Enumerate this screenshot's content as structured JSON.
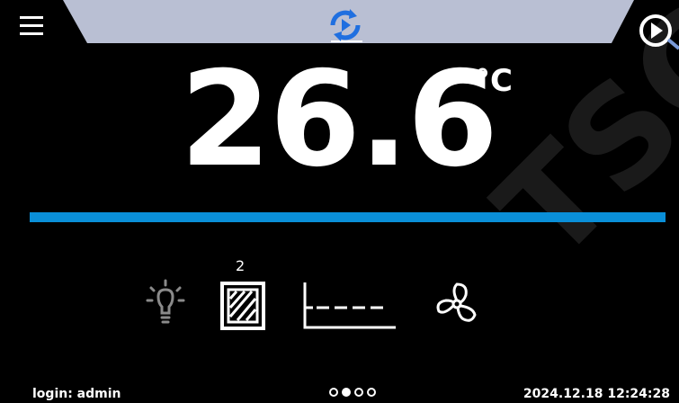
{
  "watermark": "TSCH",
  "header": {
    "mode_icon": "cycle-icon",
    "menu_icon": "hamburger-icon",
    "play_icon": "play-circle-icon"
  },
  "main": {
    "temperature": "26.6",
    "unit": "°C",
    "progress_fraction": 1.0,
    "progress_color": "#0a8fd8"
  },
  "status_icons": {
    "light": "lightbulb-icon",
    "shelves": "shelves-icon",
    "shelf_count": "2",
    "profile": "step-profile-icon",
    "fan": "fan-icon"
  },
  "footer": {
    "login": "login: admin",
    "datetime": "2024.12.18 12:24:28",
    "pages": [
      false,
      true,
      false,
      false
    ]
  },
  "colors": {
    "header_bar": "#b9bfd3",
    "accent_blue": "#0a8fd8",
    "background": "#000000"
  }
}
